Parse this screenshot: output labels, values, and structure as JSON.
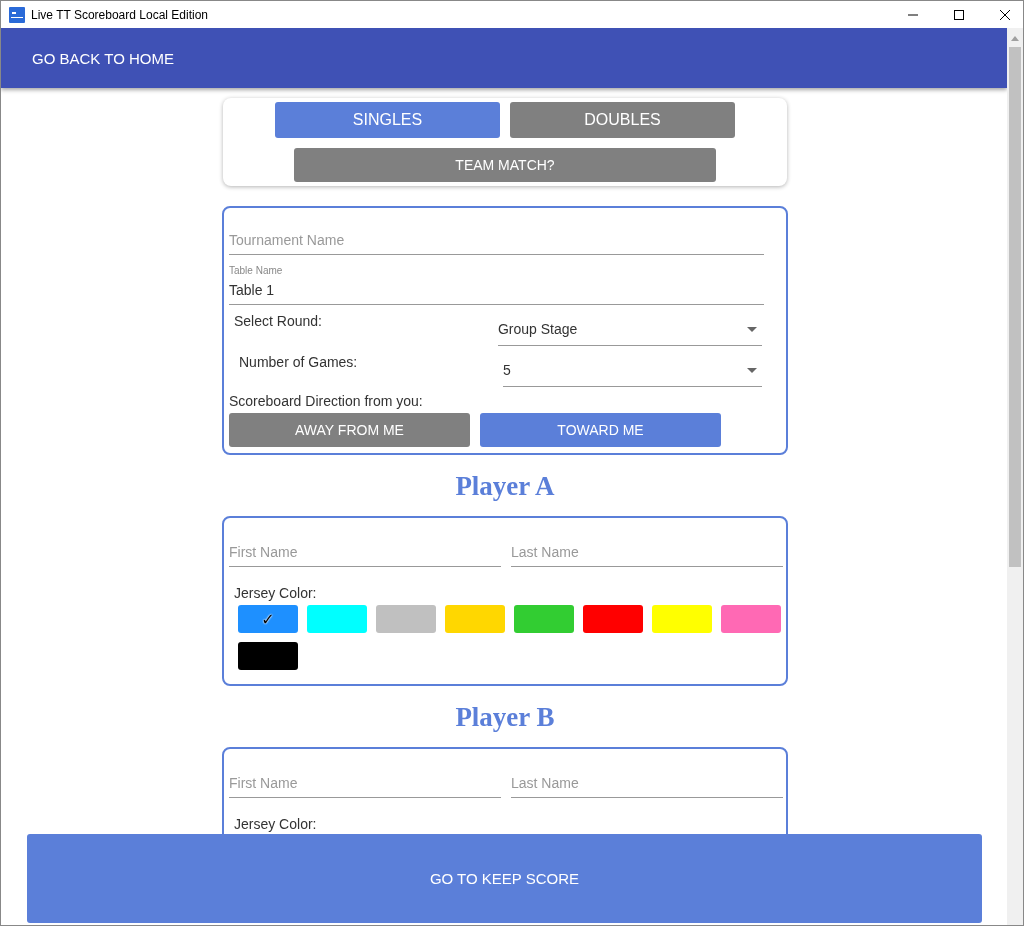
{
  "window": {
    "title": "Live TT Scoreboard Local Edition"
  },
  "app_bar": {
    "back_button": "GO BACK TO HOME"
  },
  "match_types": [
    {
      "label": "SINGLES",
      "selected": true
    },
    {
      "label": "DOUBLES",
      "selected": false
    },
    {
      "label": "TEAM MATCH?",
      "selected": false
    }
  ],
  "settings": {
    "tournament_name": {
      "placeholder": "Tournament Name"
    },
    "table_name": {
      "label": "Table Name",
      "value": "Table 1"
    },
    "round": {
      "label": "Select Round:",
      "value": "Group Stage"
    },
    "games": {
      "label": "Number of Games:",
      "value": "5"
    },
    "direction_label": "Scoreboard Direction from you:",
    "directions": [
      {
        "label": "AWAY FROM ME",
        "selected": false
      },
      {
        "label": "TOWARD ME",
        "selected": true
      }
    ]
  },
  "players": [
    {
      "title": "Player A",
      "first_name": {
        "placeholder": "First Name"
      },
      "last_name": {
        "placeholder": "Last Name"
      },
      "jersey_label": "Jersey Color:",
      "check_glyph": "✓",
      "jersey_colors": [
        {
          "color": "#1e90ff",
          "selected": true
        },
        {
          "color": "#00ffff",
          "selected": false
        },
        {
          "color": "#c0c0c0",
          "selected": false
        },
        {
          "color": "#ffd700",
          "selected": false
        },
        {
          "color": "#32cd32",
          "selected": false
        },
        {
          "color": "#ff0000",
          "selected": false
        },
        {
          "color": "#ffff00",
          "selected": false
        },
        {
          "color": "#ff69b4",
          "selected": false
        },
        {
          "color": "#000000",
          "selected": false
        }
      ]
    },
    {
      "title": "Player B",
      "first_name": {
        "placeholder": "First Name"
      },
      "last_name": {
        "placeholder": "Last Name"
      },
      "jersey_label": "Jersey Color:"
    }
  ],
  "footer_button": "GO TO KEEP SCORE"
}
